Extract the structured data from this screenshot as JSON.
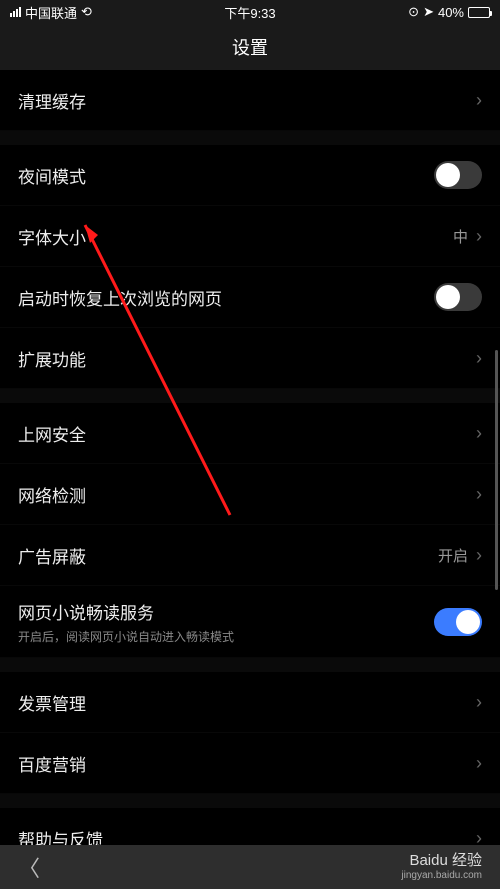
{
  "status": {
    "carrier": "中国联通",
    "time": "下午9:33",
    "battery_pct": "40%"
  },
  "header": {
    "title": "设置"
  },
  "rows": {
    "clear_cache": {
      "label": "清理缓存"
    },
    "night_mode": {
      "label": "夜间模式",
      "on": false
    },
    "font_size": {
      "label": "字体大小",
      "value": "中"
    },
    "restore_tabs": {
      "label": "启动时恢复上次浏览的网页",
      "on": false
    },
    "extensions": {
      "label": "扩展功能"
    },
    "security": {
      "label": "上网安全"
    },
    "network_check": {
      "label": "网络检测"
    },
    "ad_block": {
      "label": "广告屏蔽",
      "value": "开启"
    },
    "novel": {
      "label": "网页小说畅读服务",
      "sub": "开启后，阅读网页小说自动进入畅读模式",
      "on": true
    },
    "invoice": {
      "label": "发票管理"
    },
    "marketing": {
      "label": "百度营销"
    },
    "help": {
      "label": "帮助与反馈"
    }
  },
  "watermark": {
    "brand": "Baidu 经验",
    "url": "jingyan.baidu.com"
  }
}
